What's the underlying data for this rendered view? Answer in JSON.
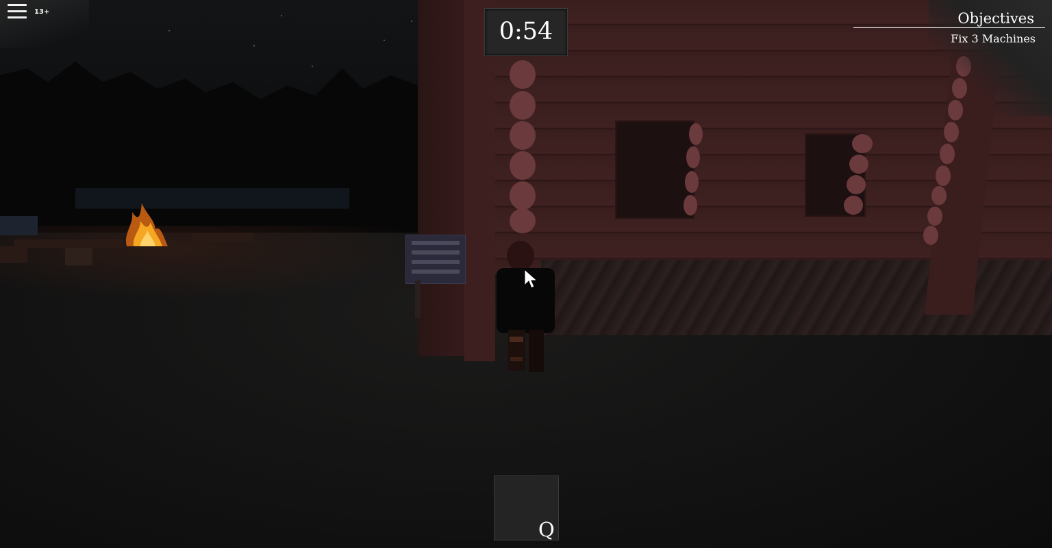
{
  "hud": {
    "age_badge": "13+",
    "timer": "0:54",
    "objectives_title": "Objectives",
    "objective_task": "Fix 3 Machines",
    "hotbar_key": "Q"
  },
  "icons": {
    "menu": "hamburger-menu-icon",
    "cursor": "mouse-pointer-icon"
  },
  "colors": {
    "hud_panel": "#262626",
    "hud_text": "#ffffff",
    "cabin_log": "#3f2121",
    "log_end": "#6b3a3d",
    "fire": "#f5a623"
  }
}
